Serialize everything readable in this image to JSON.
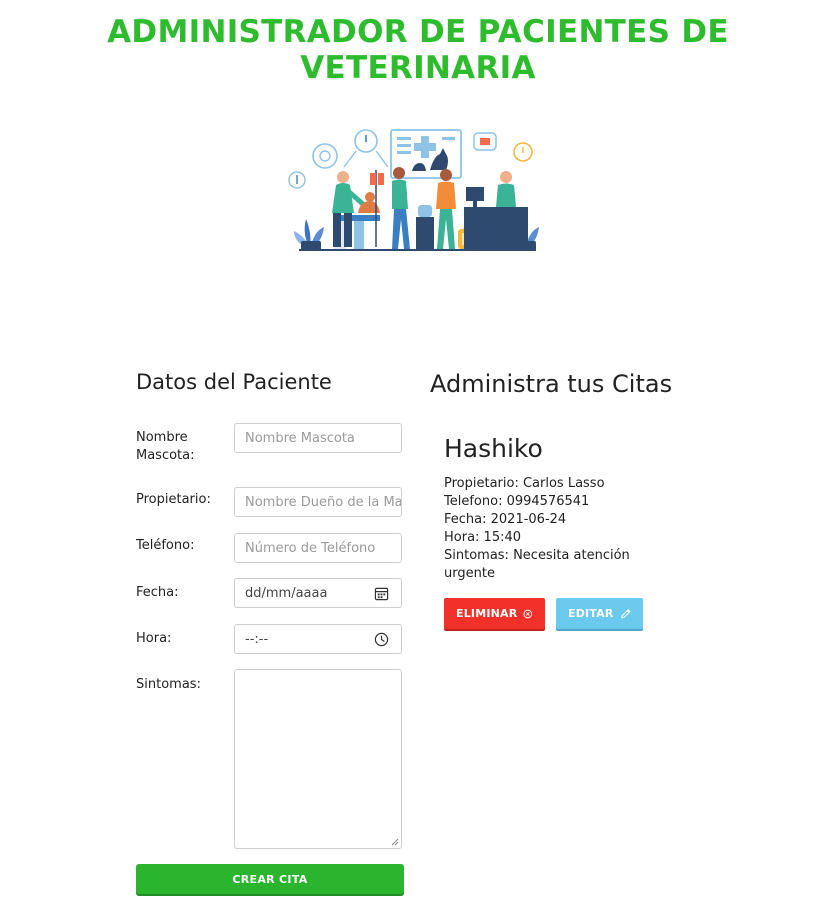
{
  "header": {
    "title": "ADMINISTRADOR DE PACIENTES DE VETERINARIA"
  },
  "form": {
    "title": "Datos del Paciente",
    "fields": [
      {
        "label": "Nombre Mascota:",
        "placeholder": "Nombre Mascota"
      },
      {
        "label": "Propietario:",
        "placeholder": "Nombre Dueño de la Mascota"
      },
      {
        "label": "Teléfono:",
        "placeholder": "Número de Teléfono"
      },
      {
        "label": "Fecha:",
        "placeholder": "dd/mm/aaaa"
      },
      {
        "label": "Hora:",
        "placeholder": "--:--"
      },
      {
        "label": "Sintomas:",
        "placeholder": ""
      }
    ],
    "submit_label": "CREAR CITA"
  },
  "appointments": {
    "title": "Administra tus Citas",
    "items": [
      {
        "pet": "Hashiko",
        "owner": "Propietario: Carlos Lasso",
        "phone": "Telefono: 0994576541",
        "date": "Fecha: 2021-06-24",
        "time": "Hora: 15:40",
        "symptoms": "Sintomas: Necesita atención urgente",
        "delete_label": "ELIMINAR",
        "edit_label": "EDITAR"
      }
    ]
  },
  "colors": {
    "title_green": "#2ebc2e",
    "submit_green": "#2bb52f",
    "delete_red": "#f2322a",
    "edit_blue": "#6cc9ee"
  },
  "icons": [
    "calendar-icon",
    "clock-icon",
    "close-circle-icon",
    "pencil-icon"
  ]
}
